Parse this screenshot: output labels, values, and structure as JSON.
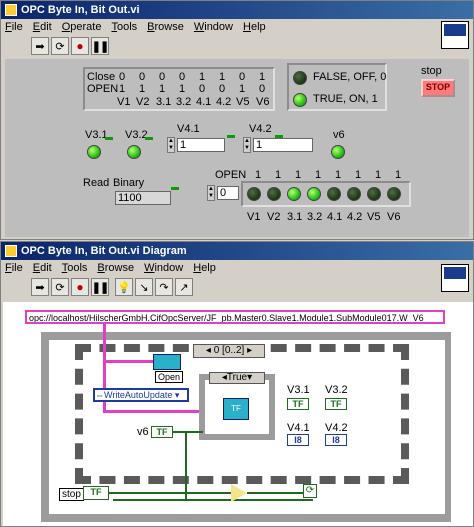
{
  "front_panel": {
    "title": "OPC Byte In, Bit Out.vi",
    "menu": [
      "File",
      "Edit",
      "Operate",
      "Tools",
      "Browse",
      "Window",
      "Help"
    ],
    "table": {
      "row1_label": "Close",
      "row1_values": [
        "0",
        "0",
        "0",
        "0",
        "1",
        "1",
        "0",
        "1"
      ],
      "row2_label": "OPEN",
      "row2_values": [
        "1",
        "1",
        "1",
        "1",
        "0",
        "0",
        "1",
        "0"
      ],
      "headers": [
        "V1",
        "V2",
        "3.1",
        "3.2",
        "4.1",
        "4.2",
        "V5",
        "V6"
      ]
    },
    "legend_false": "FALSE, OFF, 0",
    "legend_true": "TRUE, ON, 1",
    "stop_label": "stop",
    "stop_button": "STOP",
    "v31": "V3.1",
    "v32": "V3.2",
    "v41": "V4.1",
    "v41_value": "1",
    "v42": "V4.2",
    "v42_value": "1",
    "v6": "v6",
    "read_label": "Read",
    "binary_label": "Binary",
    "binary_value": "1100",
    "open_label": "OPEN",
    "open_values": [
      "1",
      "1",
      "1",
      "1",
      "1",
      "1",
      "1",
      "1"
    ],
    "index_value": "0",
    "led_headers": [
      "V1",
      "V2",
      "3.1",
      "3.2",
      "4.1",
      "4.2",
      "V5",
      "V6"
    ],
    "led_states": [
      0,
      0,
      1,
      1,
      0,
      0,
      0,
      0
    ]
  },
  "diagram": {
    "title": "OPC Byte In, Bit Out.vi Diagram",
    "menu": [
      "File",
      "Edit",
      "Tools",
      "Browse",
      "Window",
      "Help"
    ],
    "url": "opc://localhost/HilscherGmbH.CifOpcServer/JF_pb.Master0.Slave1.Module1.SubModule017.W_V6",
    "sequence": "0 [0..2]",
    "open_node": "Open",
    "write_mode": "WriteAutoUpdate",
    "case_label": "True",
    "v6": "v6",
    "tf": "TF",
    "i8": "I8",
    "v31": "V3.1",
    "v32": "V3.2",
    "v41": "V4.1",
    "v42": "V4.2",
    "stop": "stop"
  },
  "colors": {
    "panel": "#bdbdbd",
    "led_on": "#2fc81a",
    "led_off": "#233c1b",
    "wire_bool": "#1d6b1d",
    "wire_ref": "#e040c8",
    "stop": "#ff7a7a"
  }
}
